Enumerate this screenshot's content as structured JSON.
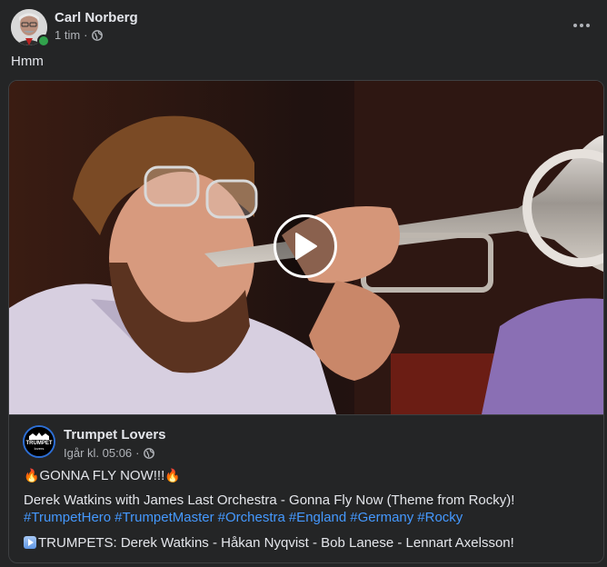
{
  "post": {
    "author": "Carl Norberg",
    "time": "1 tim",
    "separator": "·",
    "text": "Hmm",
    "privacy_icon": "globe-icon",
    "more_icon": "more-horizontal-icon"
  },
  "shared": {
    "page_name": "Trumpet Lovers",
    "page_logo_text": "TRUMPET",
    "page_logo_subtext": "lovers",
    "time": "Igår kl. 05:06",
    "separator": "·",
    "headline": "GONNA FLY NOW!!!",
    "description": "Derek Watkins with James Last Orchestra - Gonna Fly Now (Theme from Rocky)!",
    "hashtags": [
      "#TrumpetHero",
      "#TrumpetMaster",
      "#Orchestra",
      "#England",
      "#Germany",
      "#Rocky"
    ],
    "credits": "TRUMPETS: Derek Watkins - Håkan Nyqvist - Bob Lanese - Lennart Axelsson!",
    "video_play_icon": "play-icon"
  },
  "colors": {
    "background": "#242526",
    "text_primary": "#e4e6eb",
    "text_secondary": "#b0b3b8",
    "link": "#4599ff",
    "online": "#31a24c"
  }
}
